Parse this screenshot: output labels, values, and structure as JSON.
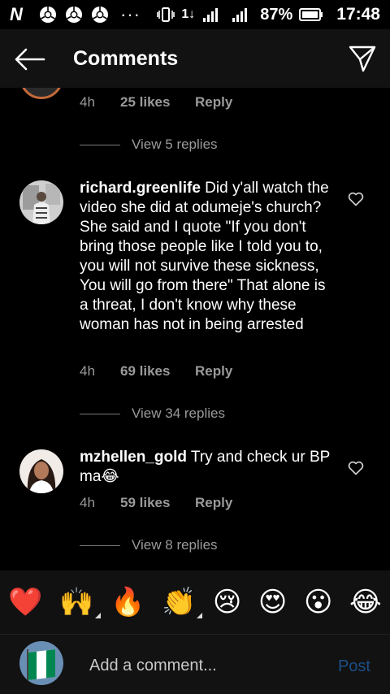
{
  "status_bar": {
    "battery_percent": "87%",
    "time": "17:48",
    "data_indicator": "1↓"
  },
  "header": {
    "title": "Comments"
  },
  "comments": [
    {
      "partial": true,
      "time": "4h",
      "likes": "25 likes",
      "reply": "Reply",
      "view_replies": "View 5 replies"
    },
    {
      "username": "richard.greenlife",
      "text": "Did y'all watch the video she did at odumeje's church? She said and I quote \"If you don't bring those people like I told you to, you will not survive these sickness, You will go from there\" That alone is a threat, I don't know why these woman has not in being arrested",
      "time": "4h",
      "likes": "69 likes",
      "reply": "Reply",
      "view_replies": "View 34 replies"
    },
    {
      "username": "mzhellen_gold",
      "text": "Try and check ur BP ma😂",
      "time": "4h",
      "likes": "59 likes",
      "reply": "Reply",
      "view_replies": "View 8 replies"
    }
  ],
  "emoji_bar": [
    {
      "glyph": "❤️",
      "name": "heart"
    },
    {
      "glyph": "🙌",
      "name": "raising-hands",
      "tones": true
    },
    {
      "glyph": "🔥",
      "name": "fire"
    },
    {
      "glyph": "👏",
      "name": "clapping-hands",
      "tones": true
    },
    {
      "glyph": "😢",
      "name": "crying-face"
    },
    {
      "glyph": "😍",
      "name": "heart-eyes"
    },
    {
      "glyph": "😮",
      "name": "surprised-face"
    },
    {
      "glyph": "😂",
      "name": "tears-of-joy"
    }
  ],
  "input": {
    "placeholder": "Add a comment...",
    "value": "",
    "post_label": "Post"
  },
  "colors": {
    "background": "#000000",
    "header_bg": "#121212",
    "muted_text": "#9a9a9a",
    "post_disabled": "#1c4f86"
  }
}
